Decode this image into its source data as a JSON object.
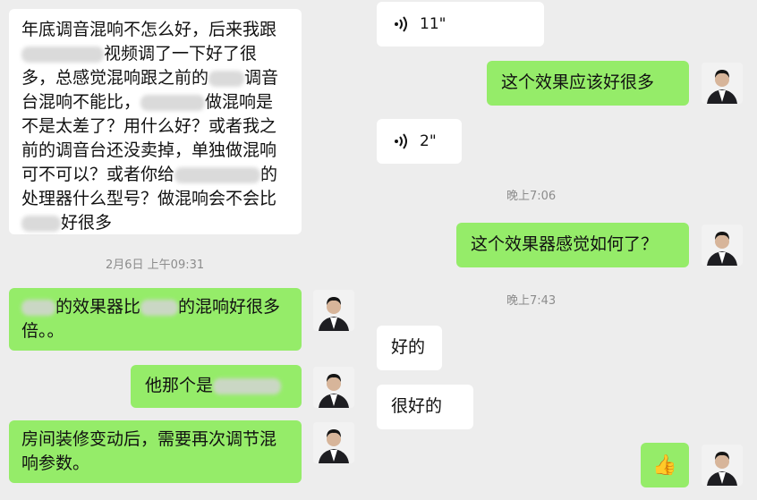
{
  "left_panel": {
    "msg_1": {
      "lines": [
        "年底调音混响不怎么好，后来我跟",
        "视频调了一下好了很",
        "多，总感觉混响跟之前的",
        "调音",
        "台混响不能比，",
        "做混响是",
        "不是太差了？用什么好？或者我之",
        "前的调音台还没卖掉，单独做混响",
        "可不可以？或者你给",
        "的",
        "处理器什么型号？做混响会不会比",
        "好很多"
      ]
    },
    "timestamp_1": "2月6日 上午09:31",
    "msg_2": {
      "line_1_a": "的效果器比",
      "line_1_b": "的混响好很多",
      "line_2": "倍。。"
    },
    "msg_3": {
      "text": "他那个是"
    },
    "msg_4": {
      "line_1": "房间装修变动后，需要再次调节混",
      "line_2": "响参数。"
    }
  },
  "right_panel": {
    "voice_1": {
      "duration": "11\""
    },
    "msg_1": {
      "text": "这个效果应该好很多"
    },
    "voice_2": {
      "duration": "2\""
    },
    "timestamp_1": "晚上7:06",
    "msg_2": {
      "text": "这个效果器感觉如何了？"
    },
    "timestamp_2": "晚上7:43",
    "msg_3": {
      "text": "好的"
    },
    "msg_4": {
      "text": "很好的"
    },
    "msg_5": {
      "emoji": "👍",
      "emoji_icon": "thumbs-up-icon"
    }
  },
  "colors": {
    "background": "#ededed",
    "sent_bubble": "#95ec69",
    "received_bubble": "#ffffff",
    "timestamp": "#8c8c8c"
  }
}
